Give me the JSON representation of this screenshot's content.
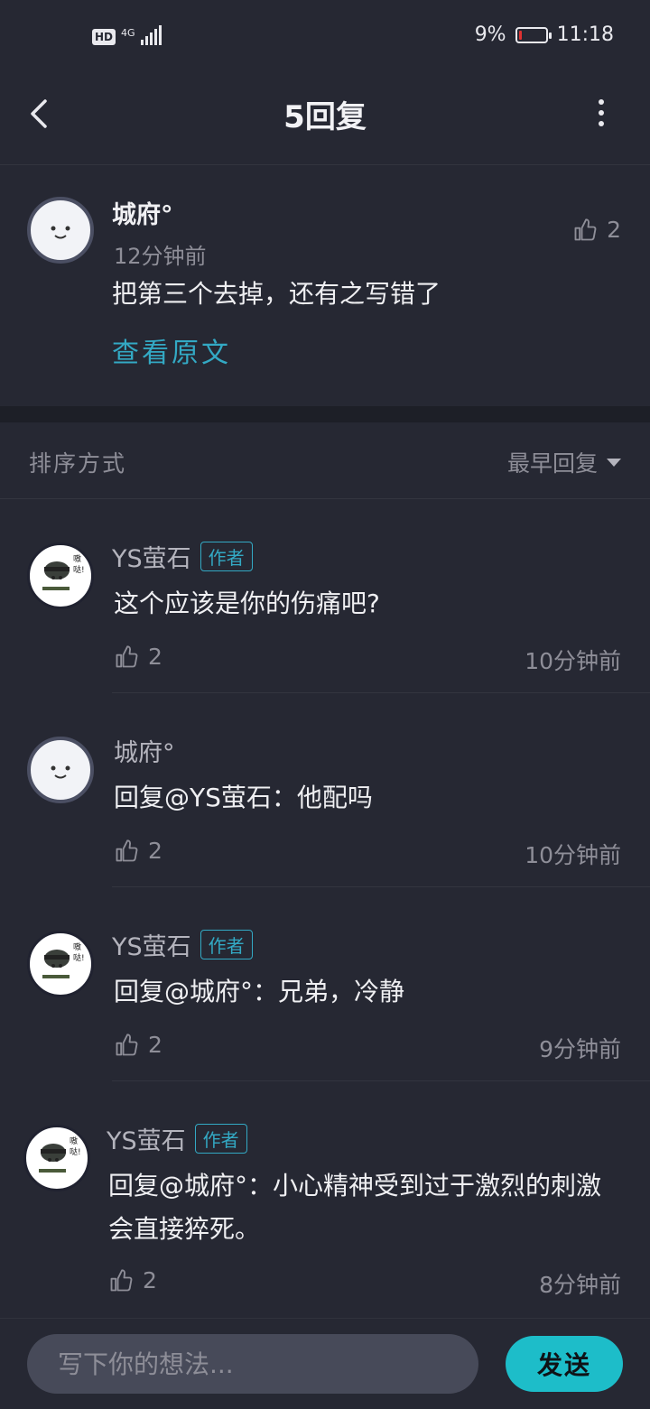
{
  "status_bar": {
    "hd": "HD",
    "network": "4G",
    "battery_percent": "9%",
    "battery_level": 0.09,
    "time": "11:18"
  },
  "header": {
    "title": "5回复"
  },
  "main_comment": {
    "author": "城府°",
    "time": "12分钟前",
    "likes": "2",
    "text": "把第三个去掉，还有之写错了",
    "view_original": "查看原文"
  },
  "sort": {
    "label": "排序方式",
    "selected": "最早回复"
  },
  "replies": [
    {
      "author": "YS萤石",
      "badge": "作者",
      "text": "这个应该是你的伤痛吧?",
      "likes": "2",
      "time": "10分钟前"
    },
    {
      "author": "城府°",
      "badge": "",
      "text": "回复@YS萤石：他配吗",
      "likes": "2",
      "time": "10分钟前"
    },
    {
      "author": "YS萤石",
      "badge": "作者",
      "text": "回复@城府°：兄弟，冷静",
      "likes": "2",
      "time": "9分钟前"
    },
    {
      "author": "YS萤石",
      "badge": "作者",
      "text": "回复@城府°：小心精神受到过于激烈的刺激会直接猝死。",
      "likes": "2",
      "time": "8分钟前"
    }
  ],
  "composer": {
    "placeholder": "写下你的想法...",
    "send_label": "发送"
  },
  "colors": {
    "accent": "#33a9c4",
    "send_button": "#1dbdc9",
    "background": "#262833",
    "battery_low": "#e03131"
  },
  "icons": [
    "back-arrow-icon",
    "more-vertical-icon",
    "thumbs-up-icon",
    "caret-down-icon",
    "signal-icon",
    "battery-icon"
  ]
}
